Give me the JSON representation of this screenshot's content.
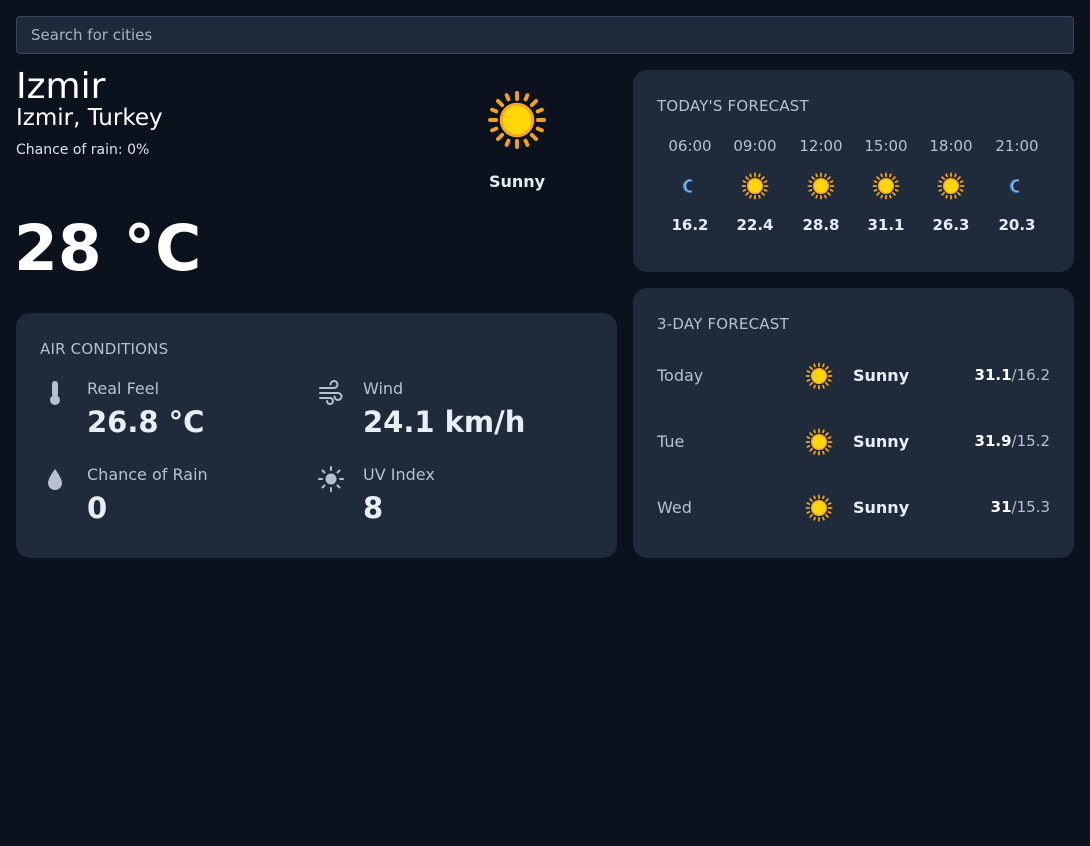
{
  "search": {
    "placeholder": "Search for cities"
  },
  "current": {
    "city": "Izmir",
    "location": "Izmir, Turkey",
    "chance_of_rain": "Chance of rain: 0%",
    "condition": "Sunny",
    "condition_icon": "sun-icon",
    "temperature": "28 °C"
  },
  "air_conditions": {
    "title": "AIR CONDITIONS",
    "items": [
      {
        "label": "Real Feel",
        "value": "26.8 °C",
        "icon": "thermometer-icon"
      },
      {
        "label": "Wind",
        "value": "24.1 km/h",
        "icon": "wind-icon"
      },
      {
        "label": "Chance of Rain",
        "value": "0",
        "icon": "raindrop-icon"
      },
      {
        "label": "UV Index",
        "value": "8",
        "icon": "uv-sun-icon"
      }
    ]
  },
  "todays_forecast": {
    "title": "TODAY'S FORECAST",
    "hours": [
      {
        "time": "06:00",
        "icon": "moon-icon",
        "temp": "16.2"
      },
      {
        "time": "09:00",
        "icon": "sun-icon",
        "temp": "22.4"
      },
      {
        "time": "12:00",
        "icon": "sun-icon",
        "temp": "28.8"
      },
      {
        "time": "15:00",
        "icon": "sun-icon",
        "temp": "31.1"
      },
      {
        "time": "18:00",
        "icon": "sun-icon",
        "temp": "26.3"
      },
      {
        "time": "21:00",
        "icon": "moon-icon",
        "temp": "20.3"
      }
    ]
  },
  "three_day_forecast": {
    "title": "3-DAY FORECAST",
    "days": [
      {
        "day": "Today",
        "icon": "sun-icon",
        "condition": "Sunny",
        "max": "31.1",
        "min": "/16.2"
      },
      {
        "day": "Tue",
        "icon": "sun-icon",
        "condition": "Sunny",
        "max": "31.9",
        "min": "/15.2"
      },
      {
        "day": "Wed",
        "icon": "sun-icon",
        "condition": "Sunny",
        "max": "31",
        "min": "/15.3"
      }
    ]
  },
  "colors": {
    "background": "#0b111d",
    "card": "#1f2a3b",
    "sun_fill": "#ffd60a",
    "sun_ray": "#f5a623",
    "moon": "#2f80ed"
  }
}
